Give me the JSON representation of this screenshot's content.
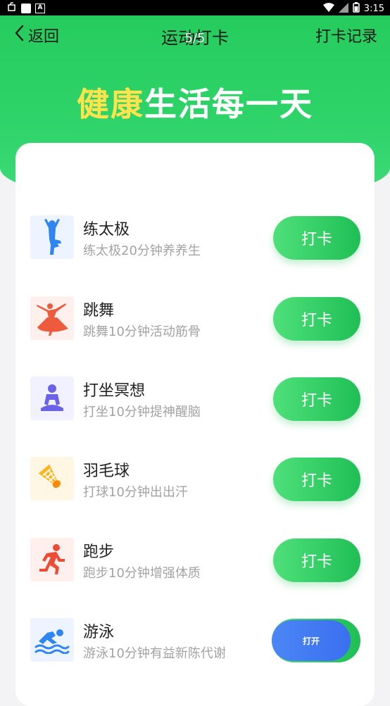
{
  "status_bar": {
    "time": "3:15",
    "icons": [
      "notification-icon",
      "square-icon",
      "a-icon",
      "wifi-icon",
      "signal-icon",
      "battery-icon"
    ]
  },
  "nav": {
    "back_label": "返回",
    "title": "运动打卡",
    "page_indicator": "5/5",
    "records_label": "打卡记录"
  },
  "slogan": {
    "part1": "健康",
    "part2": "生活每一天"
  },
  "colors": {
    "green": "#25cc5d",
    "yellow": "#ffe34d",
    "blue": "#4b86f5"
  },
  "activities": [
    {
      "title": "练太极",
      "subtitle": "练太极20分钟养养生",
      "button": "打卡",
      "icon": "tai-chi-icon"
    },
    {
      "title": "跳舞",
      "subtitle": "跳舞10分钟活动筋骨",
      "button": "打卡",
      "icon": "dance-icon"
    },
    {
      "title": "打坐冥想",
      "subtitle": "打坐10分钟提神醒脑",
      "button": "打卡",
      "icon": "meditation-icon"
    },
    {
      "title": "羽毛球",
      "subtitle": "打球10分钟出出汗",
      "button": "打卡",
      "icon": "shuttlecock-icon"
    },
    {
      "title": "跑步",
      "subtitle": "跑步10分钟增强体质",
      "button": "打卡",
      "icon": "running-icon"
    },
    {
      "title": "游泳",
      "subtitle": "游泳10分钟有益新陈代谢",
      "button": "打开",
      "icon": "swimming-icon"
    }
  ]
}
